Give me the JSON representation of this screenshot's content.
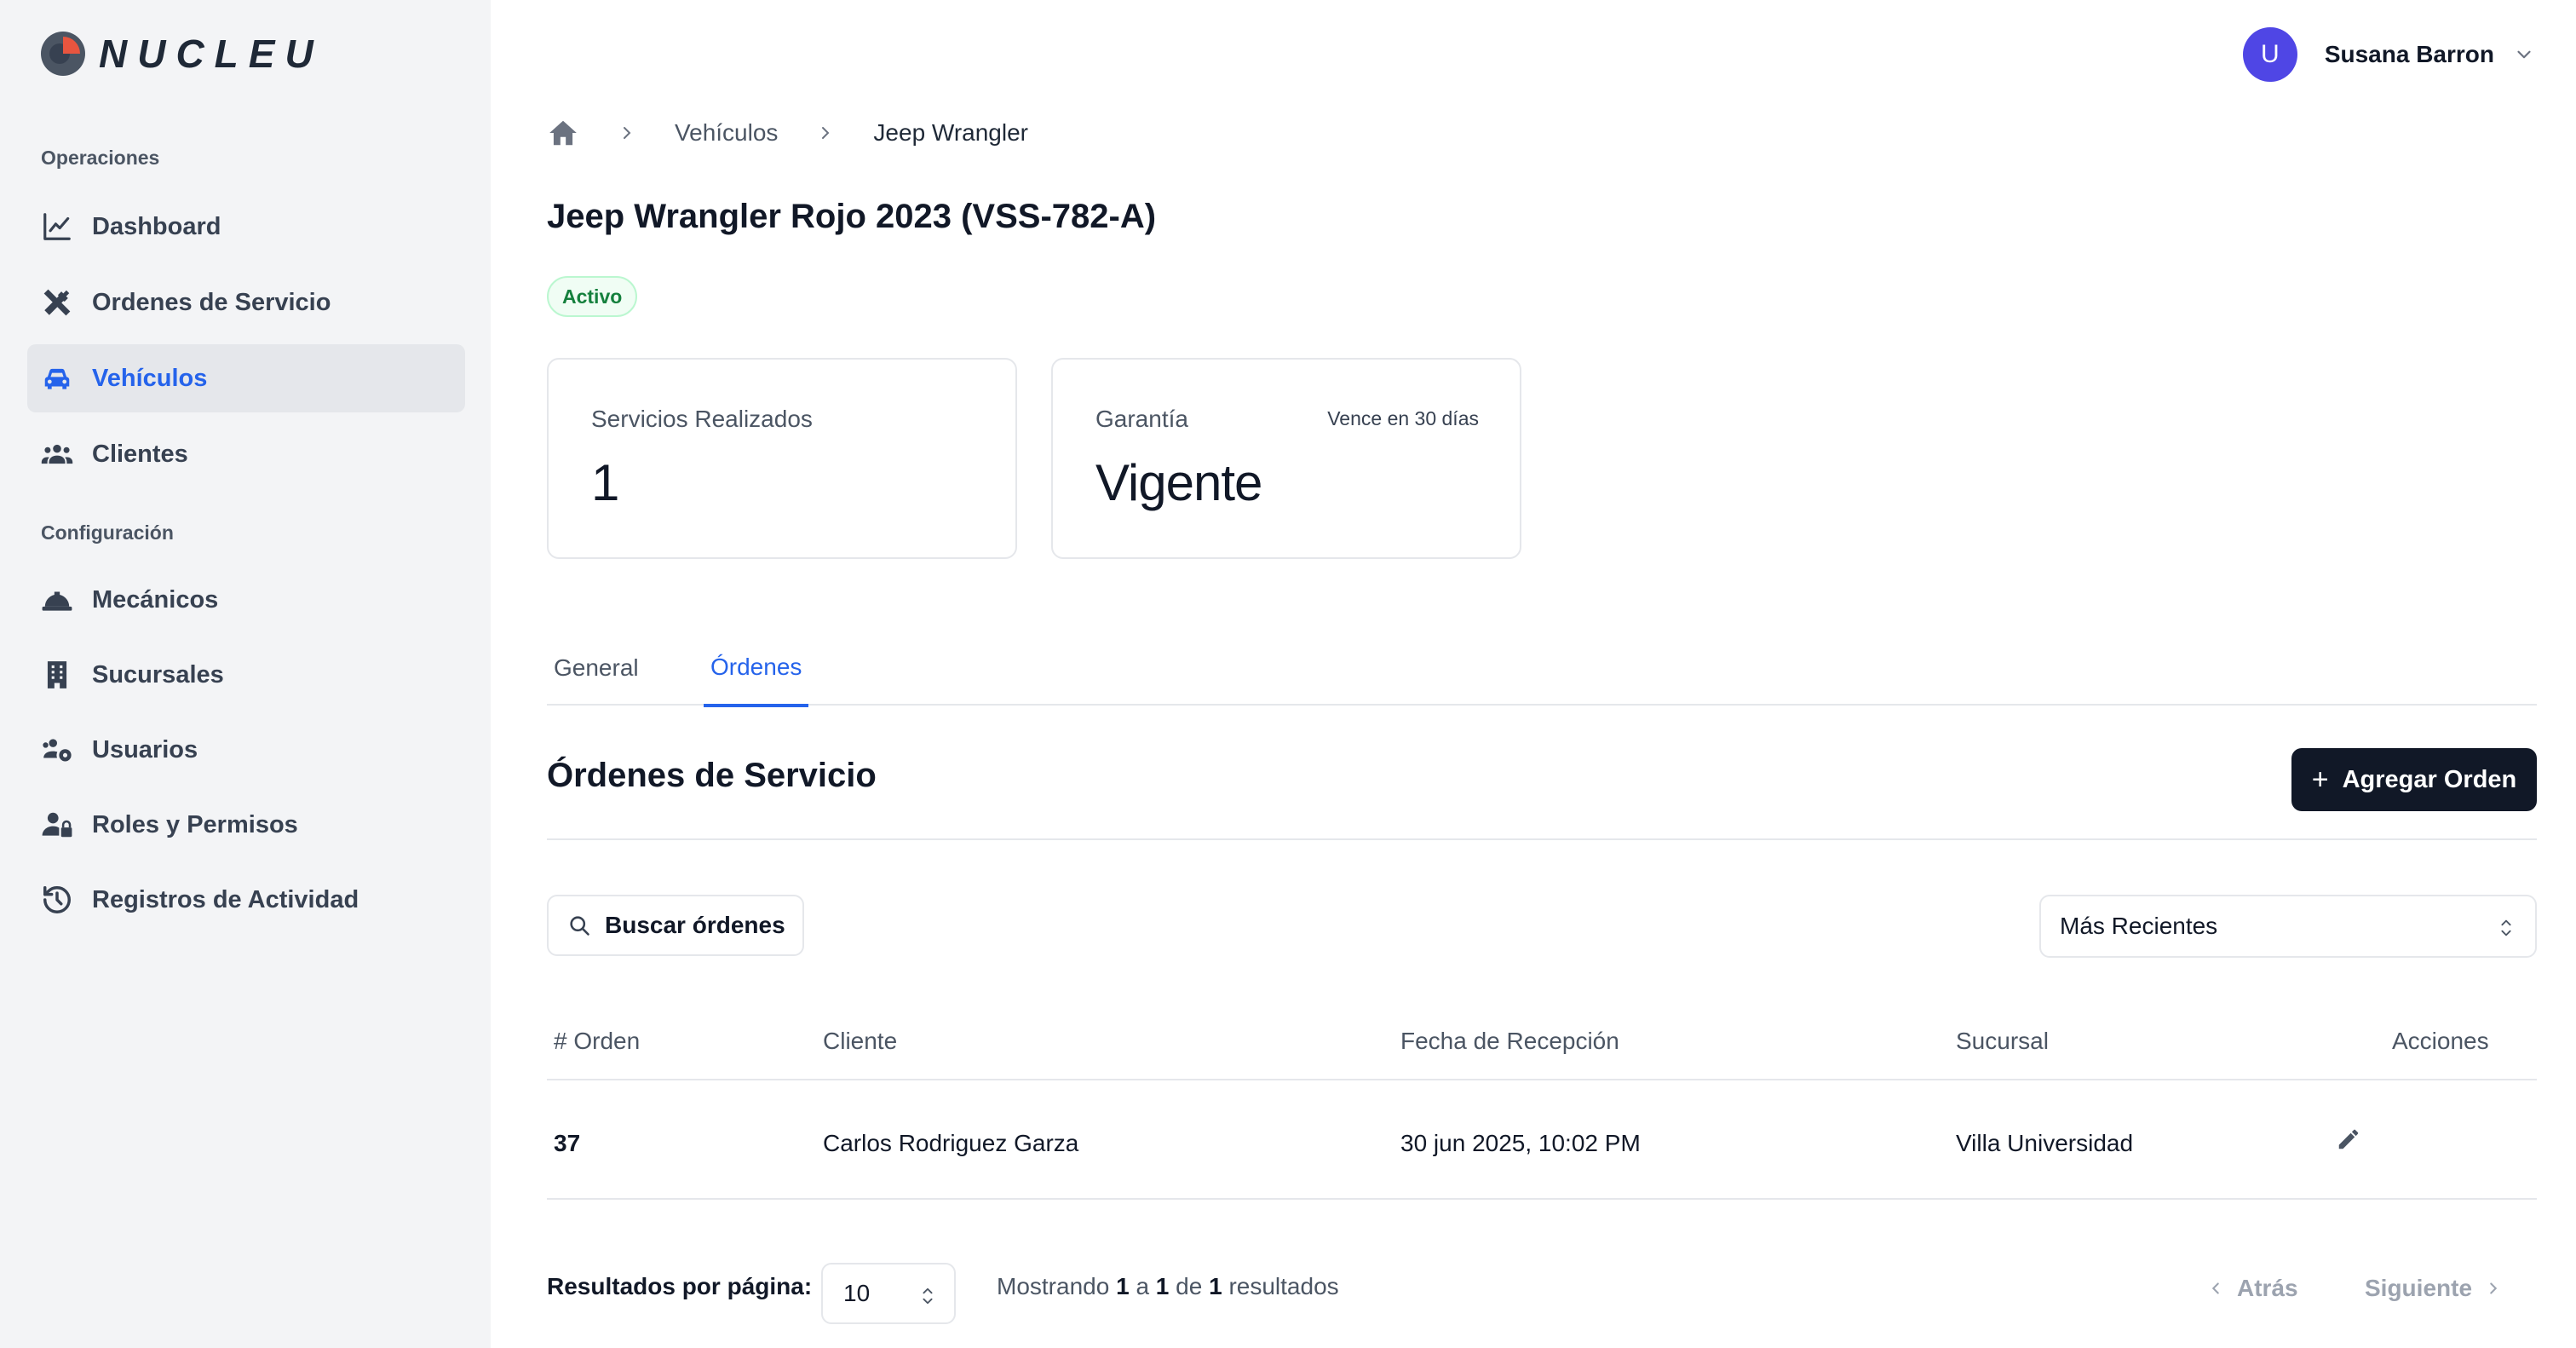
{
  "brand": {
    "name": "NUCLEU"
  },
  "sidebar": {
    "sections": [
      {
        "label": "Operaciones"
      },
      {
        "label": "Configuración"
      }
    ],
    "items": [
      {
        "label": "Dashboard",
        "icon": "chart-line-icon"
      },
      {
        "label": "Ordenes de Servicio",
        "icon": "tools-icon"
      },
      {
        "label": "Vehículos",
        "icon": "car-icon",
        "active": true
      },
      {
        "label": "Clientes",
        "icon": "users-icon"
      },
      {
        "label": "Mecánicos",
        "icon": "helmet-icon"
      },
      {
        "label": "Sucursales",
        "icon": "building-icon"
      },
      {
        "label": "Usuarios",
        "icon": "users-gear-icon"
      },
      {
        "label": "Roles y Permisos",
        "icon": "user-lock-icon"
      },
      {
        "label": "Registros de Actividad",
        "icon": "history-icon"
      }
    ]
  },
  "user": {
    "initial": "U",
    "name": "Susana Barron"
  },
  "breadcrumb": {
    "items": [
      "Vehículos",
      "Jeep Wrangler"
    ]
  },
  "vehicle": {
    "title": "Jeep Wrangler Rojo 2023 (VSS-782-A)",
    "status": "Activo"
  },
  "stats": {
    "services": {
      "label": "Servicios Realizados",
      "value": "1"
    },
    "warranty": {
      "label": "Garantía",
      "value": "Vigente",
      "note": "Vence en 30 días"
    }
  },
  "tabs": [
    {
      "label": "General",
      "active": false
    },
    {
      "label": "Órdenes",
      "active": true
    }
  ],
  "orders": {
    "title": "Órdenes de Servicio",
    "add_label": "Agregar Orden",
    "search_label": "Buscar órdenes",
    "sort_selected": "Más Recientes",
    "columns": [
      "# Orden",
      "Cliente",
      "Fecha de Recepción",
      "Sucursal",
      "Acciones"
    ],
    "rows": [
      {
        "order": "37",
        "client": "Carlos Rodriguez Garza",
        "date": "30 jun 2025, 10:02 PM",
        "branch": "Villa Universidad"
      }
    ]
  },
  "pagination": {
    "per_page_label": "Resultados por página:",
    "per_page": "10",
    "showing_prefix": "Mostrando",
    "from": "1",
    "to_word": "a",
    "to": "1",
    "of_word": "de",
    "total": "1",
    "suffix": "resultados",
    "prev_label": "Atrás",
    "next_label": "Siguiente"
  },
  "colors": {
    "accent": "#2563eb",
    "sidebar_bg": "#f3f4f6",
    "avatar": "#4f46e5",
    "status_green": "#15803d",
    "button_dark": "#111827"
  }
}
